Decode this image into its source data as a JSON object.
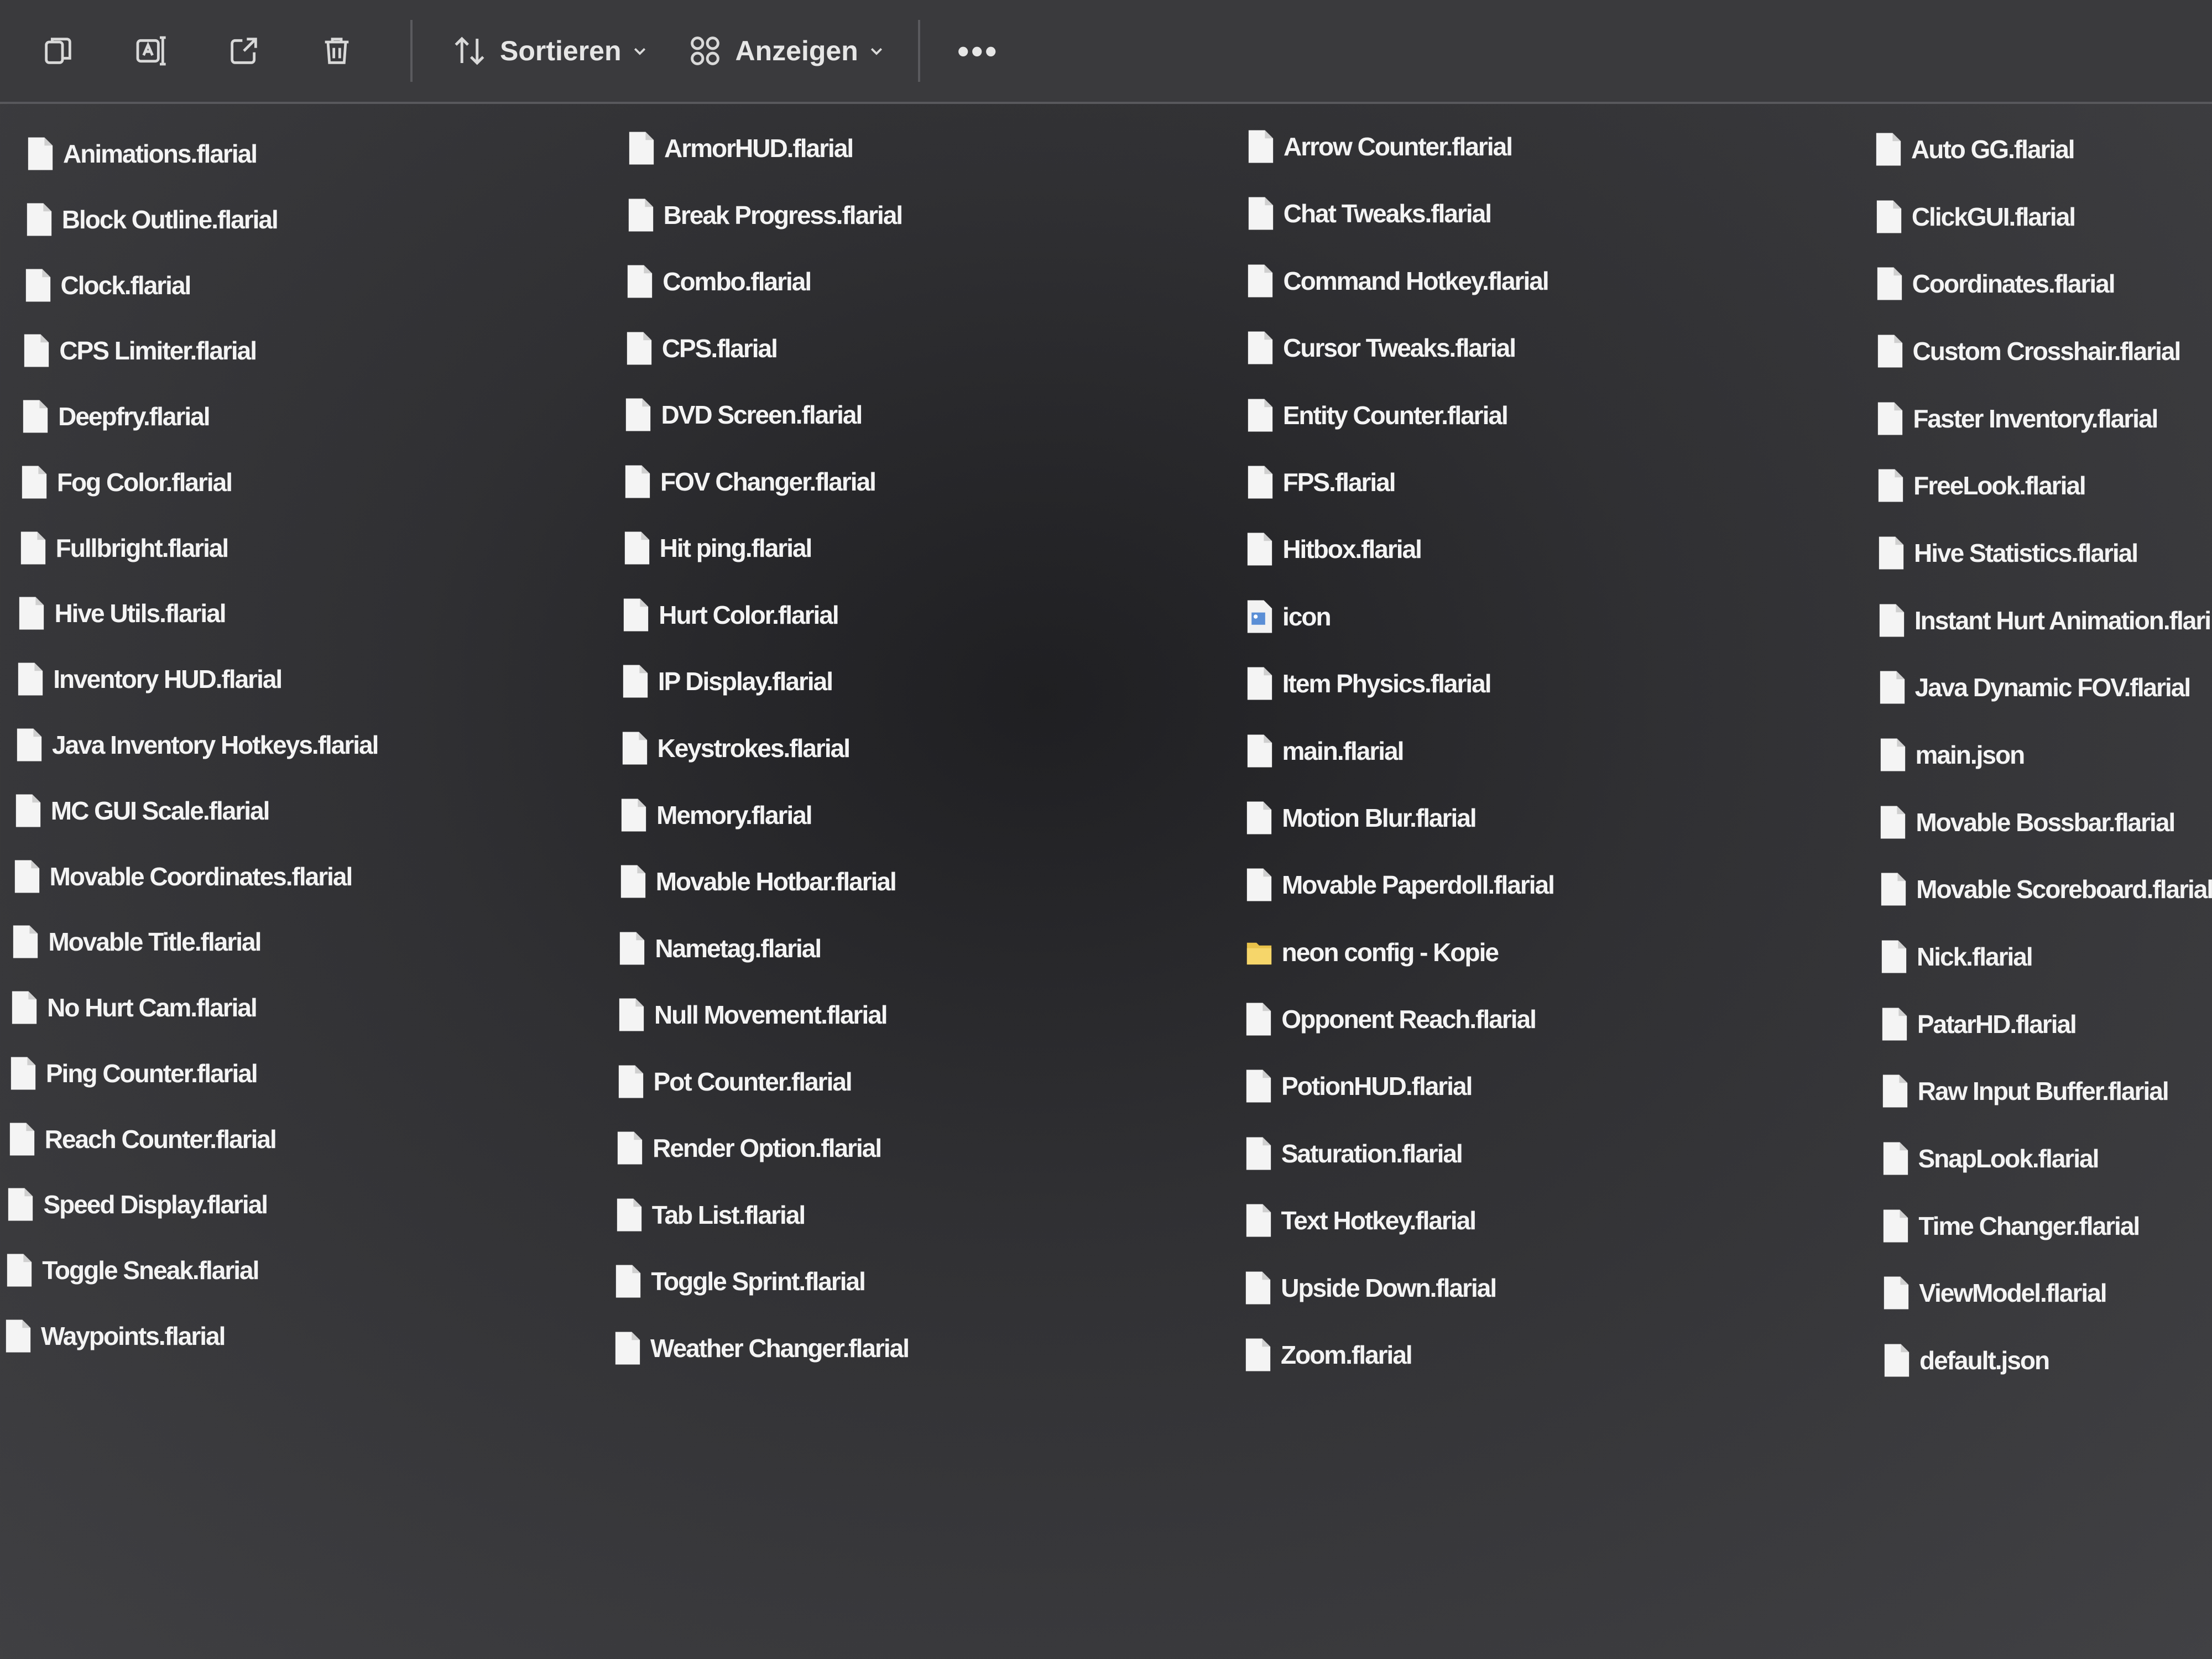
{
  "toolbar": {
    "copy_icon": "copy-icon",
    "rename_icon": "rename-icon",
    "share_icon": "share-icon",
    "delete_icon": "trash-icon",
    "sort_label": "Sortieren",
    "view_label": "Anzeigen",
    "more_label": "•••"
  },
  "columns": [
    {
      "items": [
        {
          "name": "Animations.flarial",
          "type": "file"
        },
        {
          "name": "Block Outline.flarial",
          "type": "file"
        },
        {
          "name": "Clock.flarial",
          "type": "file"
        },
        {
          "name": "CPS Limiter.flarial",
          "type": "file"
        },
        {
          "name": "Deepfry.flarial",
          "type": "file"
        },
        {
          "name": "Fog Color.flarial",
          "type": "file"
        },
        {
          "name": "Fullbright.flarial",
          "type": "file"
        },
        {
          "name": "Hive Utils.flarial",
          "type": "file"
        },
        {
          "name": "Inventory HUD.flarial",
          "type": "file"
        },
        {
          "name": "Java Inventory Hotkeys.flarial",
          "type": "file"
        },
        {
          "name": "MC GUI Scale.flarial",
          "type": "file"
        },
        {
          "name": "Movable Coordinates.flarial",
          "type": "file"
        },
        {
          "name": "Movable Title.flarial",
          "type": "file"
        },
        {
          "name": "No Hurt Cam.flarial",
          "type": "file"
        },
        {
          "name": "Ping Counter.flarial",
          "type": "file"
        },
        {
          "name": "Reach Counter.flarial",
          "type": "file"
        },
        {
          "name": "Speed Display.flarial",
          "type": "file"
        },
        {
          "name": "Toggle Sneak.flarial",
          "type": "file"
        },
        {
          "name": "Waypoints.flarial",
          "type": "file"
        }
      ]
    },
    {
      "items": [
        {
          "name": "ArmorHUD.flarial",
          "type": "file"
        },
        {
          "name": "Break Progress.flarial",
          "type": "file"
        },
        {
          "name": "Combo.flarial",
          "type": "file"
        },
        {
          "name": "CPS.flarial",
          "type": "file"
        },
        {
          "name": "DVD Screen.flarial",
          "type": "file"
        },
        {
          "name": "FOV Changer.flarial",
          "type": "file"
        },
        {
          "name": "Hit ping.flarial",
          "type": "file"
        },
        {
          "name": "Hurt Color.flarial",
          "type": "file"
        },
        {
          "name": "IP Display.flarial",
          "type": "file"
        },
        {
          "name": "Keystrokes.flarial",
          "type": "file"
        },
        {
          "name": "Memory.flarial",
          "type": "file"
        },
        {
          "name": "Movable Hotbar.flarial",
          "type": "file"
        },
        {
          "name": "Nametag.flarial",
          "type": "file"
        },
        {
          "name": "Null Movement.flarial",
          "type": "file"
        },
        {
          "name": "Pot Counter.flarial",
          "type": "file"
        },
        {
          "name": "Render Option.flarial",
          "type": "file"
        },
        {
          "name": "Tab List.flarial",
          "type": "file"
        },
        {
          "name": "Toggle Sprint.flarial",
          "type": "file"
        },
        {
          "name": "Weather Changer.flarial",
          "type": "file"
        }
      ]
    },
    {
      "items": [
        {
          "name": "Arrow Counter.flarial",
          "type": "file"
        },
        {
          "name": "Chat Tweaks.flarial",
          "type": "file"
        },
        {
          "name": "Command Hotkey.flarial",
          "type": "file"
        },
        {
          "name": "Cursor Tweaks.flarial",
          "type": "file"
        },
        {
          "name": "Entity Counter.flarial",
          "type": "file"
        },
        {
          "name": "FPS.flarial",
          "type": "file"
        },
        {
          "name": "Hitbox.flarial",
          "type": "file"
        },
        {
          "name": "icon",
          "type": "image"
        },
        {
          "name": "Item Physics.flarial",
          "type": "file"
        },
        {
          "name": "main.flarial",
          "type": "file"
        },
        {
          "name": "Motion Blur.flarial",
          "type": "file"
        },
        {
          "name": "Movable Paperdoll.flarial",
          "type": "file"
        },
        {
          "name": "neon config - Kopie",
          "type": "folder"
        },
        {
          "name": "Opponent Reach.flarial",
          "type": "file"
        },
        {
          "name": "PotionHUD.flarial",
          "type": "file"
        },
        {
          "name": "Saturation.flarial",
          "type": "file"
        },
        {
          "name": "Text Hotkey.flarial",
          "type": "file"
        },
        {
          "name": "Upside Down.flarial",
          "type": "file"
        },
        {
          "name": "Zoom.flarial",
          "type": "file"
        }
      ]
    },
    {
      "items": [
        {
          "name": "Auto GG.flarial",
          "type": "file"
        },
        {
          "name": "ClickGUI.flarial",
          "type": "file"
        },
        {
          "name": "Coordinates.flarial",
          "type": "file"
        },
        {
          "name": "Custom Crosshair.flarial",
          "type": "file"
        },
        {
          "name": "Faster Inventory.flarial",
          "type": "file"
        },
        {
          "name": "FreeLook.flarial",
          "type": "file"
        },
        {
          "name": "Hive Statistics.flarial",
          "type": "file"
        },
        {
          "name": "Instant Hurt Animation.flari",
          "type": "file"
        },
        {
          "name": "Java Dynamic FOV.flarial",
          "type": "file"
        },
        {
          "name": "main.json",
          "type": "file"
        },
        {
          "name": "Movable Bossbar.flarial",
          "type": "file"
        },
        {
          "name": "Movable Scoreboard.flarial",
          "type": "file"
        },
        {
          "name": "Nick.flarial",
          "type": "file"
        },
        {
          "name": "PatarHD.flarial",
          "type": "file"
        },
        {
          "name": "Raw Input Buffer.flarial",
          "type": "file"
        },
        {
          "name": "SnapLook.flarial",
          "type": "file"
        },
        {
          "name": "Time Changer.flarial",
          "type": "file"
        },
        {
          "name": "ViewModel.flarial",
          "type": "file"
        },
        {
          "name": "default.json",
          "type": "file"
        }
      ]
    }
  ]
}
